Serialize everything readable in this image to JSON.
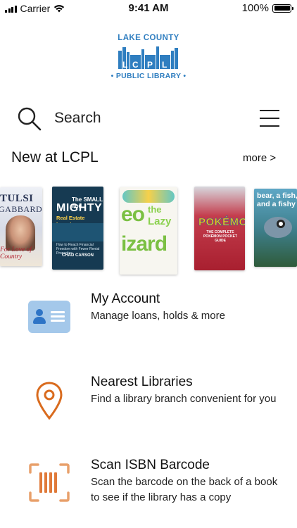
{
  "status_bar": {
    "carrier": "Carrier",
    "time": "9:41 AM",
    "battery": "100%"
  },
  "logo": {
    "top_text": "LAKE COUNTY",
    "initials": [
      "L",
      "C",
      "P",
      "L"
    ],
    "bottom_text": "• PUBLIC LIBRARY •"
  },
  "search": {
    "label": "Search"
  },
  "new_section": {
    "title": "New at LCPL",
    "more_label": "more >"
  },
  "books": [
    {
      "title_line1": "TULSI",
      "title_line2": "GABBARD",
      "subtitle": "For Love of Country"
    },
    {
      "small": "The SMALL and",
      "title": "MIGHTY",
      "subtitle": "Real Estate Investor",
      "tagline": "How to Reach Financial Freedom with Fewer Rental Properties",
      "author": "CHAD CARSON"
    },
    {
      "title_leo": "eo",
      "title_the": "the",
      "title_lazy": "Lazy",
      "title_lizard": "izard"
    },
    {
      "title": "POKÉMON",
      "subtitle": "THE COMPLETE POKÉMON POCKET GUIDE"
    },
    {
      "title": "bear, a fish, and a fishy"
    }
  ],
  "menu_items": [
    {
      "title": "My Account",
      "subtitle": "Manage loans, holds & more",
      "icon": "id-card-icon",
      "color": "#2e74c6"
    },
    {
      "title": "Nearest Libraries",
      "subtitle": "Find a library branch convenient for you",
      "icon": "location-pin-icon",
      "color": "#d96b1e"
    },
    {
      "title": "Scan ISBN Barcode",
      "subtitle": "Scan the barcode on the back of a book to see if the library has a copy",
      "icon": "barcode-icon",
      "color": "#e8a06b"
    }
  ],
  "colors": {
    "brand_blue": "#2f7ec0",
    "book_red": "#c33b2e",
    "book_green": "#6fb43a",
    "book_orange": "#e79a2b"
  }
}
